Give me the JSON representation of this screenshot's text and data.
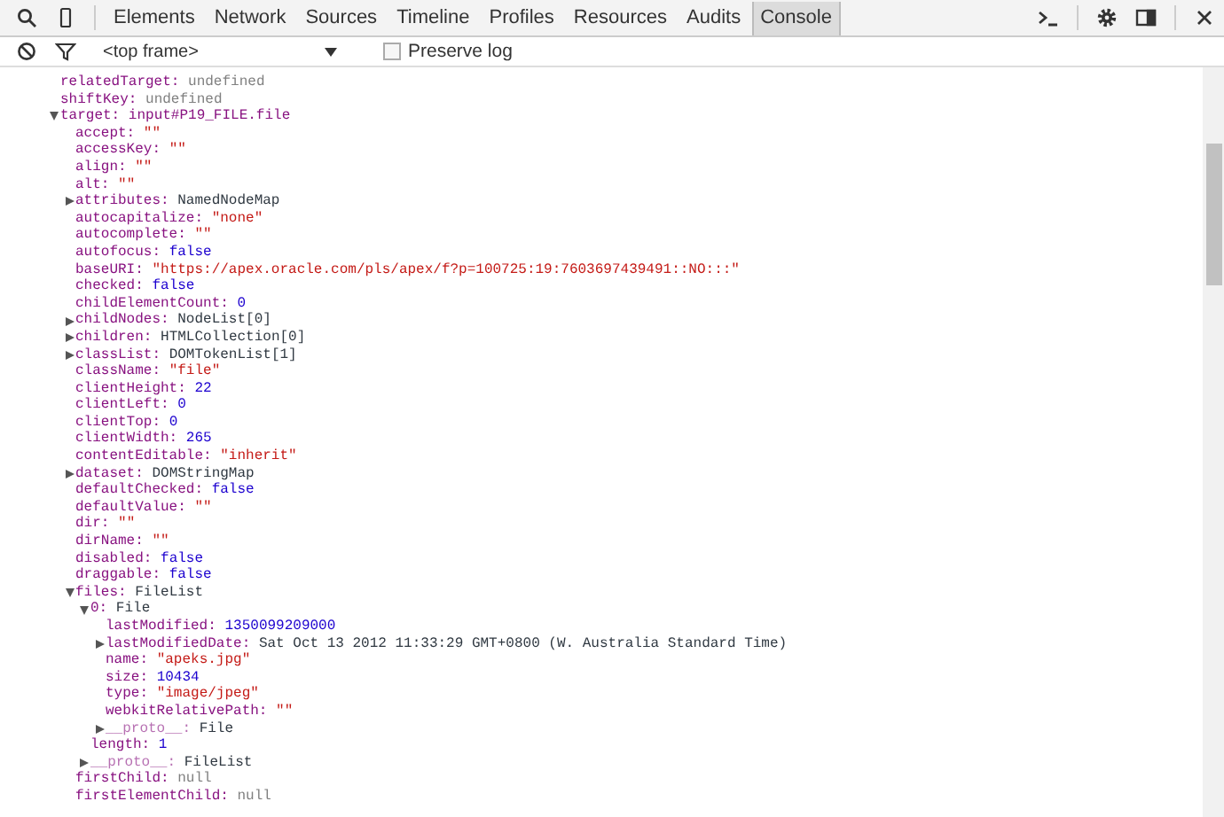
{
  "toolbar": {
    "tabs": [
      {
        "label": "Elements",
        "selected": false
      },
      {
        "label": "Network",
        "selected": false
      },
      {
        "label": "Sources",
        "selected": false
      },
      {
        "label": "Timeline",
        "selected": false
      },
      {
        "label": "Profiles",
        "selected": false
      },
      {
        "label": "Resources",
        "selected": false
      },
      {
        "label": "Audits",
        "selected": false
      },
      {
        "label": "Console",
        "selected": true
      }
    ]
  },
  "filter_bar": {
    "frame_select": "<top frame>",
    "preserve_log": {
      "label": "Preserve log",
      "checked": false
    }
  },
  "console": {
    "properties": [
      {
        "key": "relatedTarget:",
        "value": "undefined",
        "kind": "undefined"
      },
      {
        "key": "shiftKey:",
        "value": "undefined",
        "kind": "undefined"
      },
      {
        "key": "target:",
        "value": "input#P19_FILE.file",
        "kind": "node",
        "expanded": true,
        "children": [
          {
            "key": "accept:",
            "value": "\"\"",
            "kind": "string"
          },
          {
            "key": "accessKey:",
            "value": "\"\"",
            "kind": "string"
          },
          {
            "key": "align:",
            "value": "\"\"",
            "kind": "string"
          },
          {
            "key": "alt:",
            "value": "\"\"",
            "kind": "string"
          },
          {
            "key": "attributes:",
            "value": "NamedNodeMap",
            "kind": "object",
            "expanded": false
          },
          {
            "key": "autocapitalize:",
            "value": "\"none\"",
            "kind": "string"
          },
          {
            "key": "autocomplete:",
            "value": "\"\"",
            "kind": "string"
          },
          {
            "key": "autofocus:",
            "value": "false",
            "kind": "boolean"
          },
          {
            "key": "baseURI:",
            "value": "\"https://apex.oracle.com/pls/apex/f?p=100725:19:7603697439491::NO:::\"",
            "kind": "string"
          },
          {
            "key": "checked:",
            "value": "false",
            "kind": "boolean"
          },
          {
            "key": "childElementCount:",
            "value": "0",
            "kind": "number"
          },
          {
            "key": "childNodes:",
            "value": "NodeList[0]",
            "kind": "object",
            "expanded": false
          },
          {
            "key": "children:",
            "value": "HTMLCollection[0]",
            "kind": "object",
            "expanded": false
          },
          {
            "key": "classList:",
            "value": "DOMTokenList[1]",
            "kind": "object",
            "expanded": false
          },
          {
            "key": "className:",
            "value": "\"file\"",
            "kind": "string"
          },
          {
            "key": "clientHeight:",
            "value": "22",
            "kind": "number"
          },
          {
            "key": "clientLeft:",
            "value": "0",
            "kind": "number"
          },
          {
            "key": "clientTop:",
            "value": "0",
            "kind": "number"
          },
          {
            "key": "clientWidth:",
            "value": "265",
            "kind": "number"
          },
          {
            "key": "contentEditable:",
            "value": "\"inherit\"",
            "kind": "string"
          },
          {
            "key": "dataset:",
            "value": "DOMStringMap",
            "kind": "object",
            "expanded": false
          },
          {
            "key": "defaultChecked:",
            "value": "false",
            "kind": "boolean"
          },
          {
            "key": "defaultValue:",
            "value": "\"\"",
            "kind": "string"
          },
          {
            "key": "dir:",
            "value": "\"\"",
            "kind": "string"
          },
          {
            "key": "dirName:",
            "value": "\"\"",
            "kind": "string"
          },
          {
            "key": "disabled:",
            "value": "false",
            "kind": "boolean"
          },
          {
            "key": "draggable:",
            "value": "false",
            "kind": "boolean"
          },
          {
            "key": "files:",
            "value": "FileList",
            "kind": "object",
            "expanded": true,
            "children": [
              {
                "key": "0:",
                "value": "File",
                "kind": "object",
                "expanded": true,
                "children": [
                  {
                    "key": "lastModified:",
                    "value": "1350099209000",
                    "kind": "number"
                  },
                  {
                    "key": "lastModifiedDate:",
                    "value": "Sat Oct 13 2012 11:33:29 GMT+0800 (W. Australia Standard Time)",
                    "kind": "object",
                    "expanded": false
                  },
                  {
                    "key": "name:",
                    "value": "\"apeks.jpg\"",
                    "kind": "string"
                  },
                  {
                    "key": "size:",
                    "value": "10434",
                    "kind": "number"
                  },
                  {
                    "key": "type:",
                    "value": "\"image/jpeg\"",
                    "kind": "string"
                  },
                  {
                    "key": "webkitRelativePath:",
                    "value": "\"\"",
                    "kind": "string"
                  },
                  {
                    "key": "__proto__:",
                    "value": "File",
                    "kind": "object",
                    "expanded": false,
                    "dimmed": true
                  }
                ]
              },
              {
                "key": "length:",
                "value": "1",
                "kind": "number"
              },
              {
                "key": "__proto__:",
                "value": "FileList",
                "kind": "object",
                "expanded": false,
                "dimmed": true
              }
            ]
          },
          {
            "key": "firstChild:",
            "value": "null",
            "kind": "null"
          },
          {
            "key": "firstElementChild:",
            "value": "null",
            "kind": "null"
          }
        ]
      }
    ]
  }
}
